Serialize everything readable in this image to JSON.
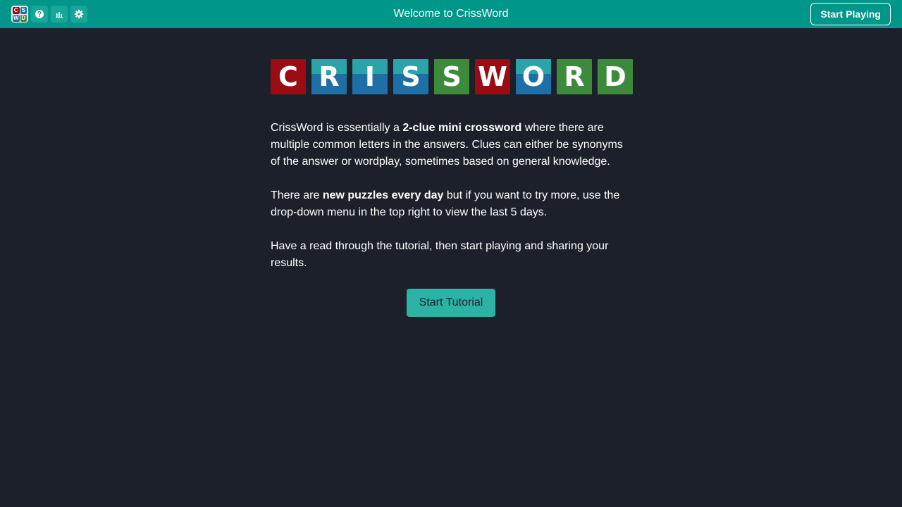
{
  "header": {
    "title": "Welcome to CrissWord",
    "start_playing_label": "Start Playing",
    "logo_letters": [
      "C",
      "S",
      "W",
      "D"
    ],
    "icons": [
      "help-icon",
      "stats-icon",
      "settings-icon"
    ]
  },
  "logo_tiles": [
    {
      "letter": "C",
      "color": "#9b0b13",
      "top_color": ""
    },
    {
      "letter": "R",
      "color": "#1e6fa6",
      "top_color": "#2aa4a8"
    },
    {
      "letter": "I",
      "color": "#1e6fa6",
      "top_color": "#2aa4a8"
    },
    {
      "letter": "S",
      "color": "#1e6fa6",
      "top_color": "#2aa4a8"
    },
    {
      "letter": "S",
      "color": "#3d8a3d",
      "top_color": ""
    },
    {
      "letter": "W",
      "color": "#9b0b13",
      "top_color": ""
    },
    {
      "letter": "O",
      "color": "#1e6fa6",
      "top_color": "#2aa4a8"
    },
    {
      "letter": "R",
      "color": "#3d8a3d",
      "top_color": ""
    },
    {
      "letter": "D",
      "color": "#3d8a3d",
      "top_color": ""
    }
  ],
  "intro": {
    "p1_a": "CrissWord is essentially a ",
    "p1_b": "2-clue mini crossword",
    "p1_c": " where there are multiple common letters in the answers. Clues can either be synonyms of the answer or wordplay, sometimes based on general knowledge.",
    "p2_a": "There are ",
    "p2_b": "new puzzles every day",
    "p2_c": " but if you want to try more, use the drop-down menu in the top right to view the last 5 days.",
    "p3": "Have a read through the tutorial, then start playing and sharing your results."
  },
  "tutorial_button": "Start Tutorial",
  "colors": {
    "header_bg": "#00968a",
    "page_bg": "#1b202b",
    "accent_button": "#2cb3a6"
  }
}
